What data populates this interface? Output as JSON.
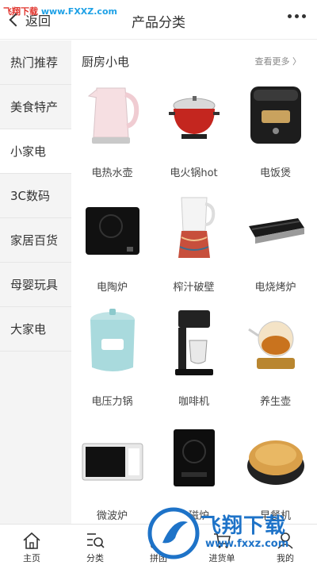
{
  "watermark_top": {
    "prefix": "飞翔下载",
    "url": "www.FXXZ.com"
  },
  "header": {
    "back_label": "返回",
    "title": "产品分类"
  },
  "sidebar": {
    "items": [
      {
        "label": "热门推荐",
        "active": false
      },
      {
        "label": "美食特产",
        "active": false
      },
      {
        "label": "小家电",
        "active": true
      },
      {
        "label": "3C数码",
        "active": false
      },
      {
        "label": "家居百货",
        "active": false
      },
      {
        "label": "母婴玩具",
        "active": false
      },
      {
        "label": "大家电",
        "active": false
      }
    ]
  },
  "section": {
    "title": "厨房小电",
    "more_label": "查看更多 〉",
    "products": [
      {
        "label": "电热水壶",
        "icon": "kettle-icon"
      },
      {
        "label": "电火锅hot",
        "icon": "hotpot-icon"
      },
      {
        "label": "电饭煲",
        "icon": "rice-cooker-icon"
      },
      {
        "label": "电陶炉",
        "icon": "ceramic-stove-icon"
      },
      {
        "label": "榨汁破壁",
        "icon": "blender-icon"
      },
      {
        "label": "电烧烤炉",
        "icon": "grill-icon"
      },
      {
        "label": "电压力锅",
        "icon": "pressure-cooker-icon"
      },
      {
        "label": "咖啡机",
        "icon": "coffee-machine-icon"
      },
      {
        "label": "养生壶",
        "icon": "health-pot-icon"
      },
      {
        "label": "微波炉",
        "icon": "microwave-icon"
      },
      {
        "label": "电磁炉",
        "icon": "induction-cooker-icon"
      },
      {
        "label": "早餐机",
        "icon": "breakfast-machine-icon"
      }
    ]
  },
  "tabbar": {
    "items": [
      {
        "label": "主页",
        "icon": "home-icon"
      },
      {
        "label": "分类",
        "icon": "category-icon"
      },
      {
        "label": "拼团",
        "icon": "group-buy-icon"
      },
      {
        "label": "进货单",
        "icon": "cart-icon"
      },
      {
        "label": "我的",
        "icon": "user-icon"
      }
    ]
  },
  "watermark_bottom": {
    "text": "飞翔下载",
    "url": "www.fxxz.com"
  },
  "colors": {
    "watermark_red": "#e0322b",
    "watermark_blue": "#1e73c8",
    "sidebar_bg": "#f4f4f4"
  }
}
